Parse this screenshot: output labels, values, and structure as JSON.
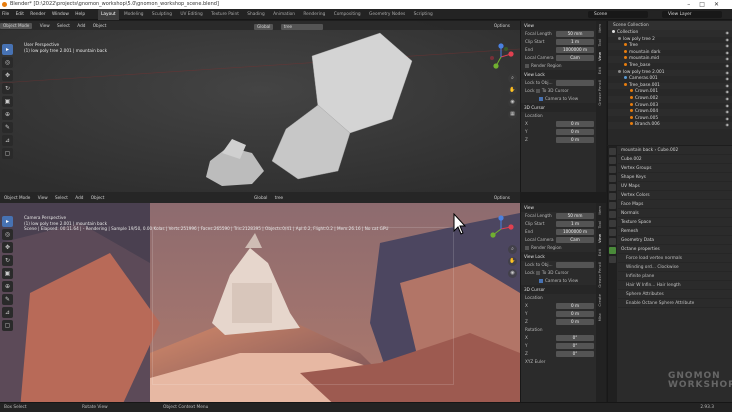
{
  "window": {
    "title": "Blender* [D:\\2022\\projects\\gnomon_workshop\\5.0\\gnomon_workshop_scene.blend]"
  },
  "menu": [
    "File",
    "Edit",
    "Render",
    "Window",
    "Help"
  ],
  "workspace_tabs": [
    "Layout",
    "Modeling",
    "Sculpting",
    "UV Editing",
    "Texture Paint",
    "Shading",
    "Animation",
    "Rendering",
    "Compositing",
    "Geometry Nodes",
    "Scripting"
  ],
  "active_tab": "Layout",
  "scene_field": "Scene",
  "viewlayer_field": "View Layer",
  "viewport_header": {
    "mode": "Object Mode",
    "view": "View",
    "select": "Select",
    "add": "Add",
    "object": "Object",
    "orientation": "Global",
    "search": "tree",
    "options": "Options"
  },
  "viewport_top": {
    "line1": "User Perspective",
    "line2": "(1) low poly tree 2.001 | mountain back"
  },
  "viewport_bottom": {
    "line1": "Camera Perspective",
    "line2": "(1) low poly tree 2.001 | mountain back",
    "line3": "Scene | Elapsed: 00:11.64 | - Rendering | Sample 19/50, 0.00 Kolas | Verts:251996 | Faces:265590 | Tris:2128395 | Objects:0/41 | Apl:0.2, Flight:0.2 | Mem:26.16 | No cat GPU"
  },
  "npanel_top": {
    "view_header": "View",
    "focal_length_label": "Focal Length",
    "focal_length": "50 mm",
    "clip_start_label": "Clip Start",
    "clip_start": "1 m",
    "end_label": "End",
    "end": "1000000 m",
    "local_camera_label": "Local Camera",
    "local_camera_value": "Cam",
    "render_region": "Render Region",
    "view_lock_header": "View Lock",
    "lock_obj_label": "Lock to Obj...",
    "lock_label": "Lock",
    "to_3d_cursor": "To 3D Cursor",
    "camera_to_view": "Camera to View",
    "cursor_header": "3D Cursor",
    "location_label": "Location",
    "x_label": "X",
    "x": "0 m",
    "y_label": "Y",
    "y": "0 m",
    "z_label": "Z",
    "z": "0 m"
  },
  "npanel_bottom": {
    "view_header": "View",
    "focal_length_label": "Focal Length",
    "focal_length": "50 mm",
    "clip_start_label": "Clip Start",
    "clip_start": "1 m",
    "end_label": "End",
    "end": "1000000 m",
    "local_camera_label": "Local Camera",
    "local_camera_value": "Cam",
    "render_region": "Render Region",
    "view_lock_header": "View Lock",
    "lock_obj_label": "Lock to Obj...",
    "lock_label": "Lock",
    "to_3d_cursor": "To 3D Cursor",
    "camera_to_view": "Camera to View",
    "cursor_header": "3D Cursor",
    "location_label": "Location",
    "x_label": "X",
    "x": "0 m",
    "y_label": "Y",
    "y": "0 m",
    "z_label": "Z",
    "z": "0 m",
    "rotation_label": "Rotation",
    "rx_label": "X",
    "rx": "0°",
    "ry_label": "Y",
    "ry": "0°",
    "rz_label": "Z",
    "rz": "0°",
    "mode": "XYZ Euler"
  },
  "side_tabs": [
    "Item",
    "Tool",
    "View",
    "Edit",
    "Grease Pencil",
    "Create",
    "Misc"
  ],
  "outliner": {
    "header": "Scene Collection",
    "rows": [
      "Collection",
      "low poly tree 2",
      "Tree",
      "mountain dark",
      "mountain.mid",
      "Tree_base",
      "low poly tree 2.001",
      "Cameras.001",
      "Tree_base.001",
      "Crown.001",
      "Crown.002",
      "Crown.003",
      "Crown.004",
      "Crown.005",
      "Branch.006"
    ]
  },
  "properties": {
    "object_name": "mountain back",
    "mesh_name": "Cube.002",
    "data_field": "Cube.002",
    "rows": [
      "Vertex Groups",
      "Shape Keys",
      "UV Maps",
      "Vertex Colors",
      "Face Maps",
      "Normals",
      "Texture Space",
      "Remesh",
      "Geometry Data",
      "Octane properties",
      "Force load vertex normals",
      "Winding ord... Clockwise",
      "Infinite plane",
      "Hair W Infin... Hair length",
      "Sphere Attributes",
      "Enable Octane Sphere Attribute"
    ]
  },
  "statusbar": {
    "select": "Box Select",
    "rotate": "Rotate View",
    "menu": "Object Context Menu",
    "version": "2.93.3"
  },
  "watermark": "GNOMON WORKSHOP"
}
